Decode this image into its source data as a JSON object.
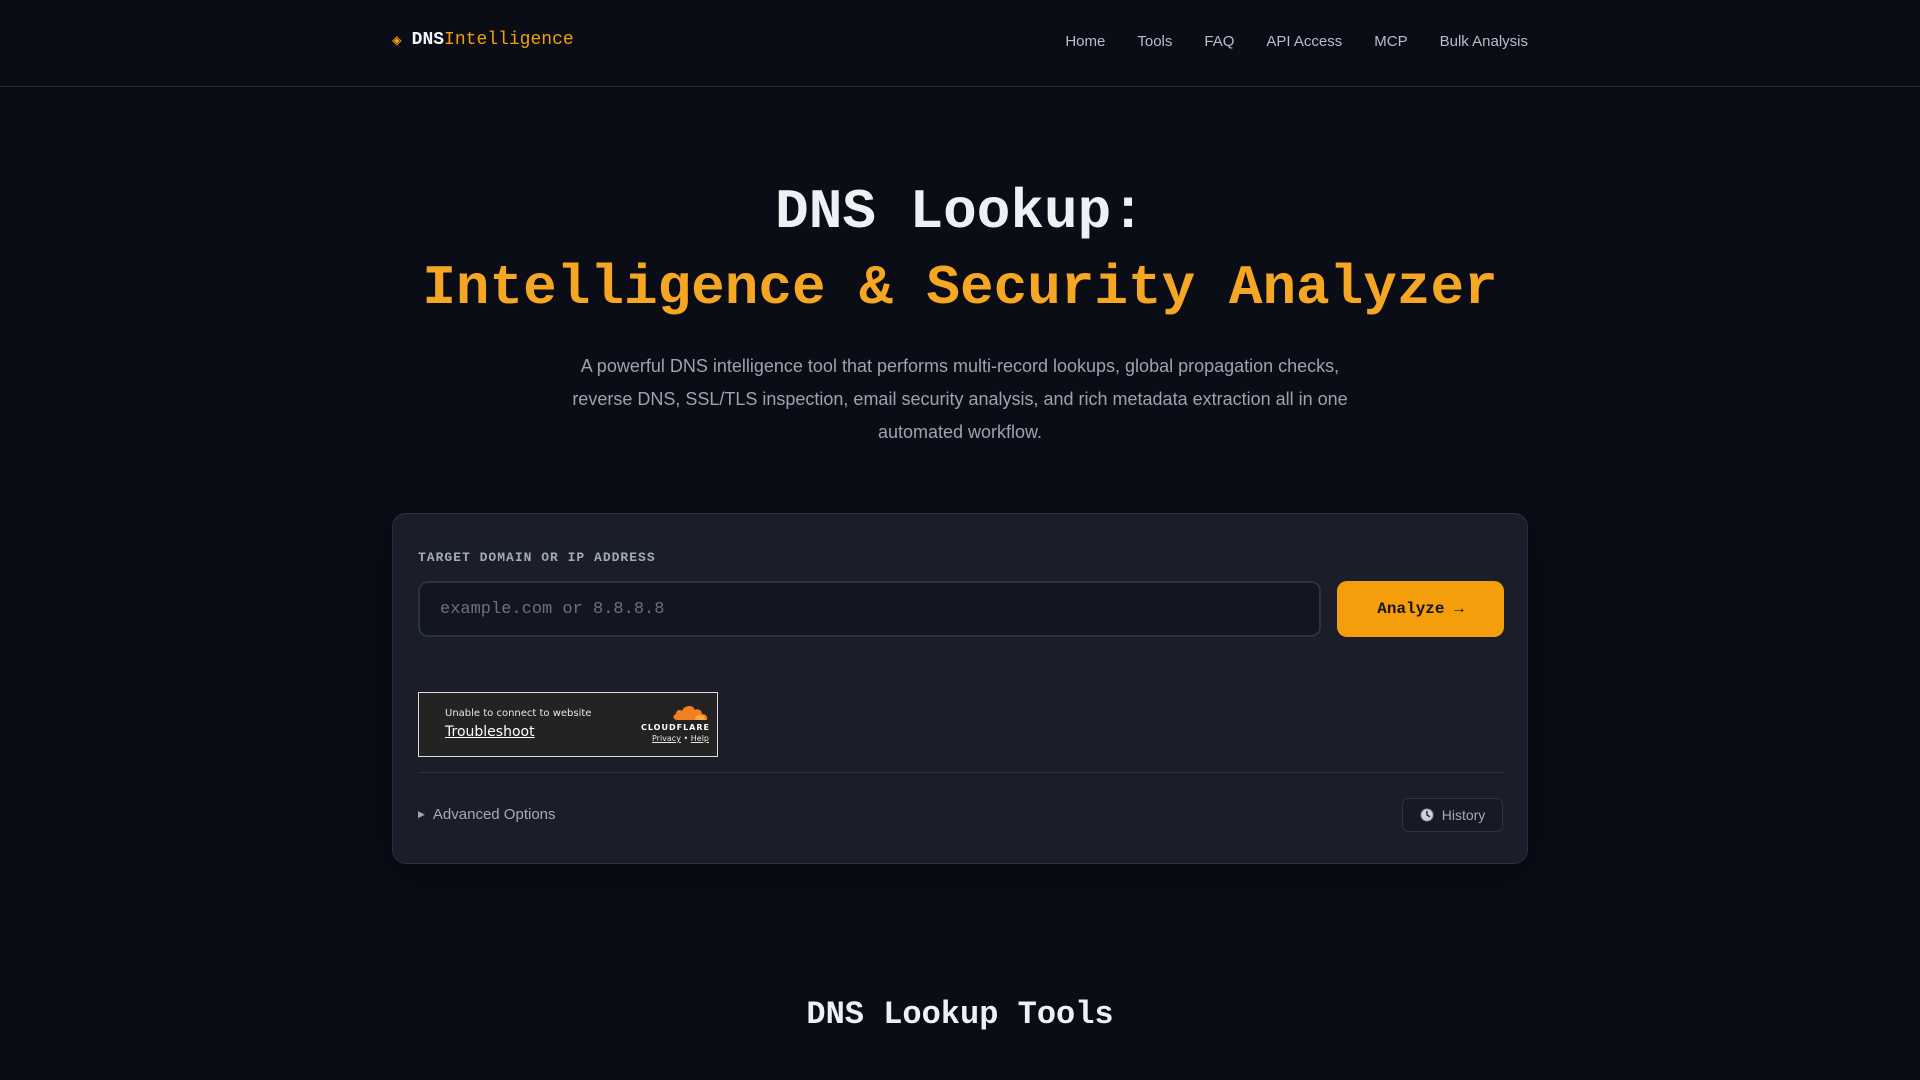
{
  "header": {
    "logo_icon": "diamond-icon",
    "logo_primary": "DNS",
    "logo_secondary": "Intelligence",
    "nav": [
      {
        "label": "Home"
      },
      {
        "label": "Tools"
      },
      {
        "label": "FAQ"
      },
      {
        "label": "API Access"
      },
      {
        "label": "MCP"
      },
      {
        "label": "Bulk Analysis"
      }
    ]
  },
  "hero": {
    "title_line1": "DNS Lookup:",
    "title_line2": "Intelligence & Security Analyzer",
    "description": "A powerful DNS intelligence tool that performs multi-record lookups, global propagation checks, reverse DNS, SSL/TLS inspection, email security analysis, and rich metadata extraction all in one automated workflow."
  },
  "lookup": {
    "label": "TARGET DOMAIN OR IP ADDRESS",
    "input_value": "",
    "placeholder": "example.com or 8.8.8.8",
    "analyze_label": "Analyze →"
  },
  "captcha": {
    "message": "Unable to connect to website",
    "troubleshoot": "Troubleshoot",
    "brand": "CLOUDFLARE",
    "privacy": "Privacy",
    "separator": "•",
    "help": "Help"
  },
  "options": {
    "advanced_label": "Advanced Options",
    "history_label": "History"
  },
  "tools_section": {
    "title": "DNS Lookup Tools"
  },
  "colors": {
    "background": "#0a0d16",
    "accent": "#f59e0b",
    "card": "#1a1e2a"
  }
}
